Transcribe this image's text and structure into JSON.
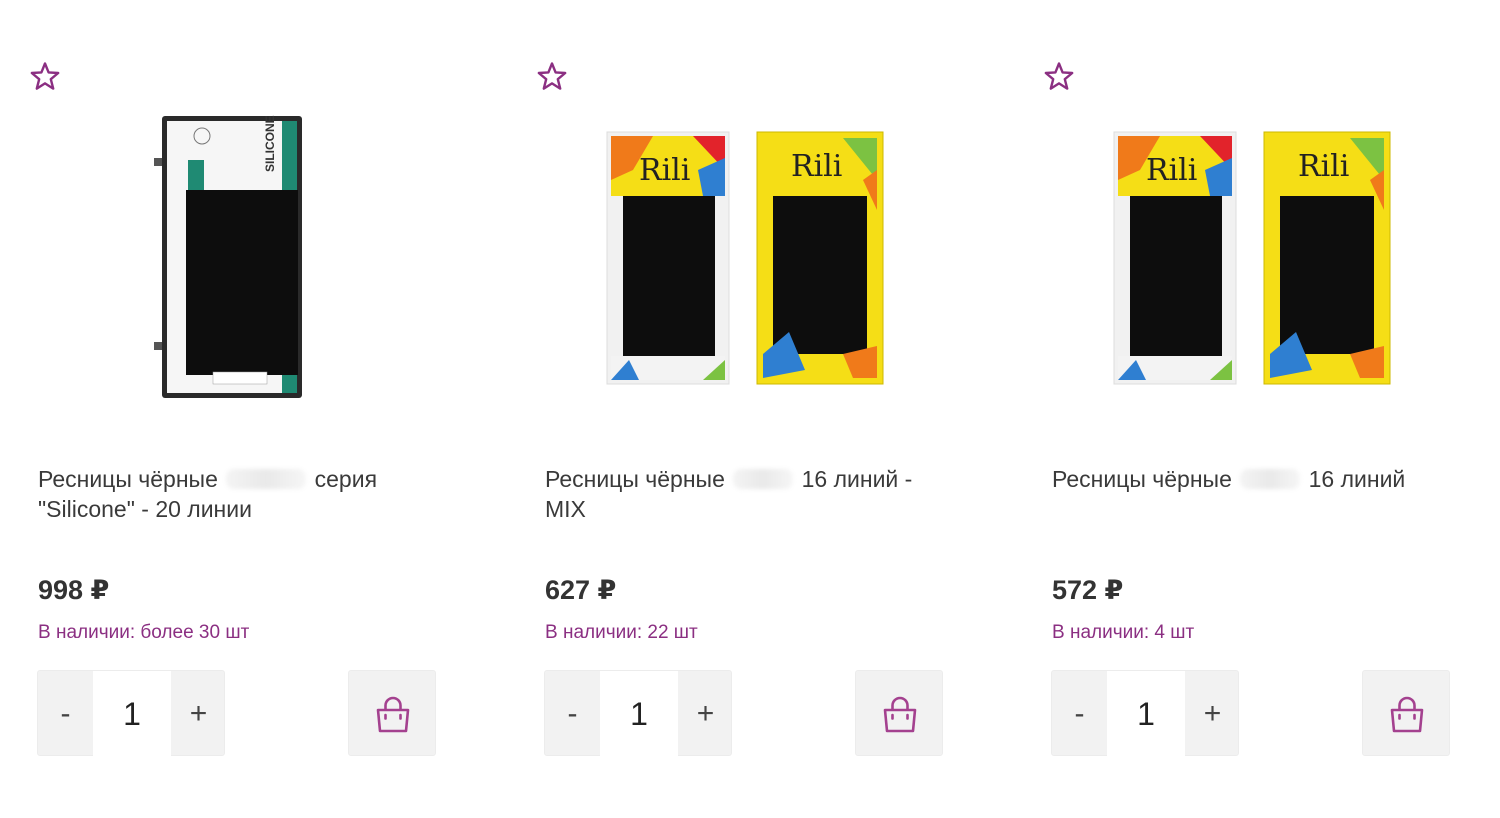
{
  "colors": {
    "accent": "#8b2f82",
    "stock": "#8b2f82",
    "button_bg": "#f2f2f2"
  },
  "products": [
    {
      "favorite_icon": "star-outline-icon",
      "image": "lovely-silicone-lash-tray",
      "title_part1": "Ресницы чёрные",
      "title_part2": "серия \"Silicone\" - 20 линии",
      "price": "998 ₽",
      "stock": "В наличии: более 30 шт",
      "qty_minus": "-",
      "qty_value": "1",
      "qty_plus": "+",
      "cart_icon": "shopping-bag-icon"
    },
    {
      "favorite_icon": "star-outline-icon",
      "image": "rili-lash-trays",
      "title_part1": "Ресницы чёрные",
      "title_part2": "16 линий - MIX",
      "price": "627 ₽",
      "stock": "В наличии: 22 шт",
      "qty_minus": "-",
      "qty_value": "1",
      "qty_plus": "+",
      "cart_icon": "shopping-bag-icon"
    },
    {
      "favorite_icon": "star-outline-icon",
      "image": "rili-lash-trays",
      "title_part1": "Ресницы чёрные",
      "title_part2": "16 линий",
      "price": "572 ₽",
      "stock": "В наличии: 4 шт",
      "qty_minus": "-",
      "qty_value": "1",
      "qty_plus": "+",
      "cart_icon": "shopping-bag-icon"
    }
  ]
}
